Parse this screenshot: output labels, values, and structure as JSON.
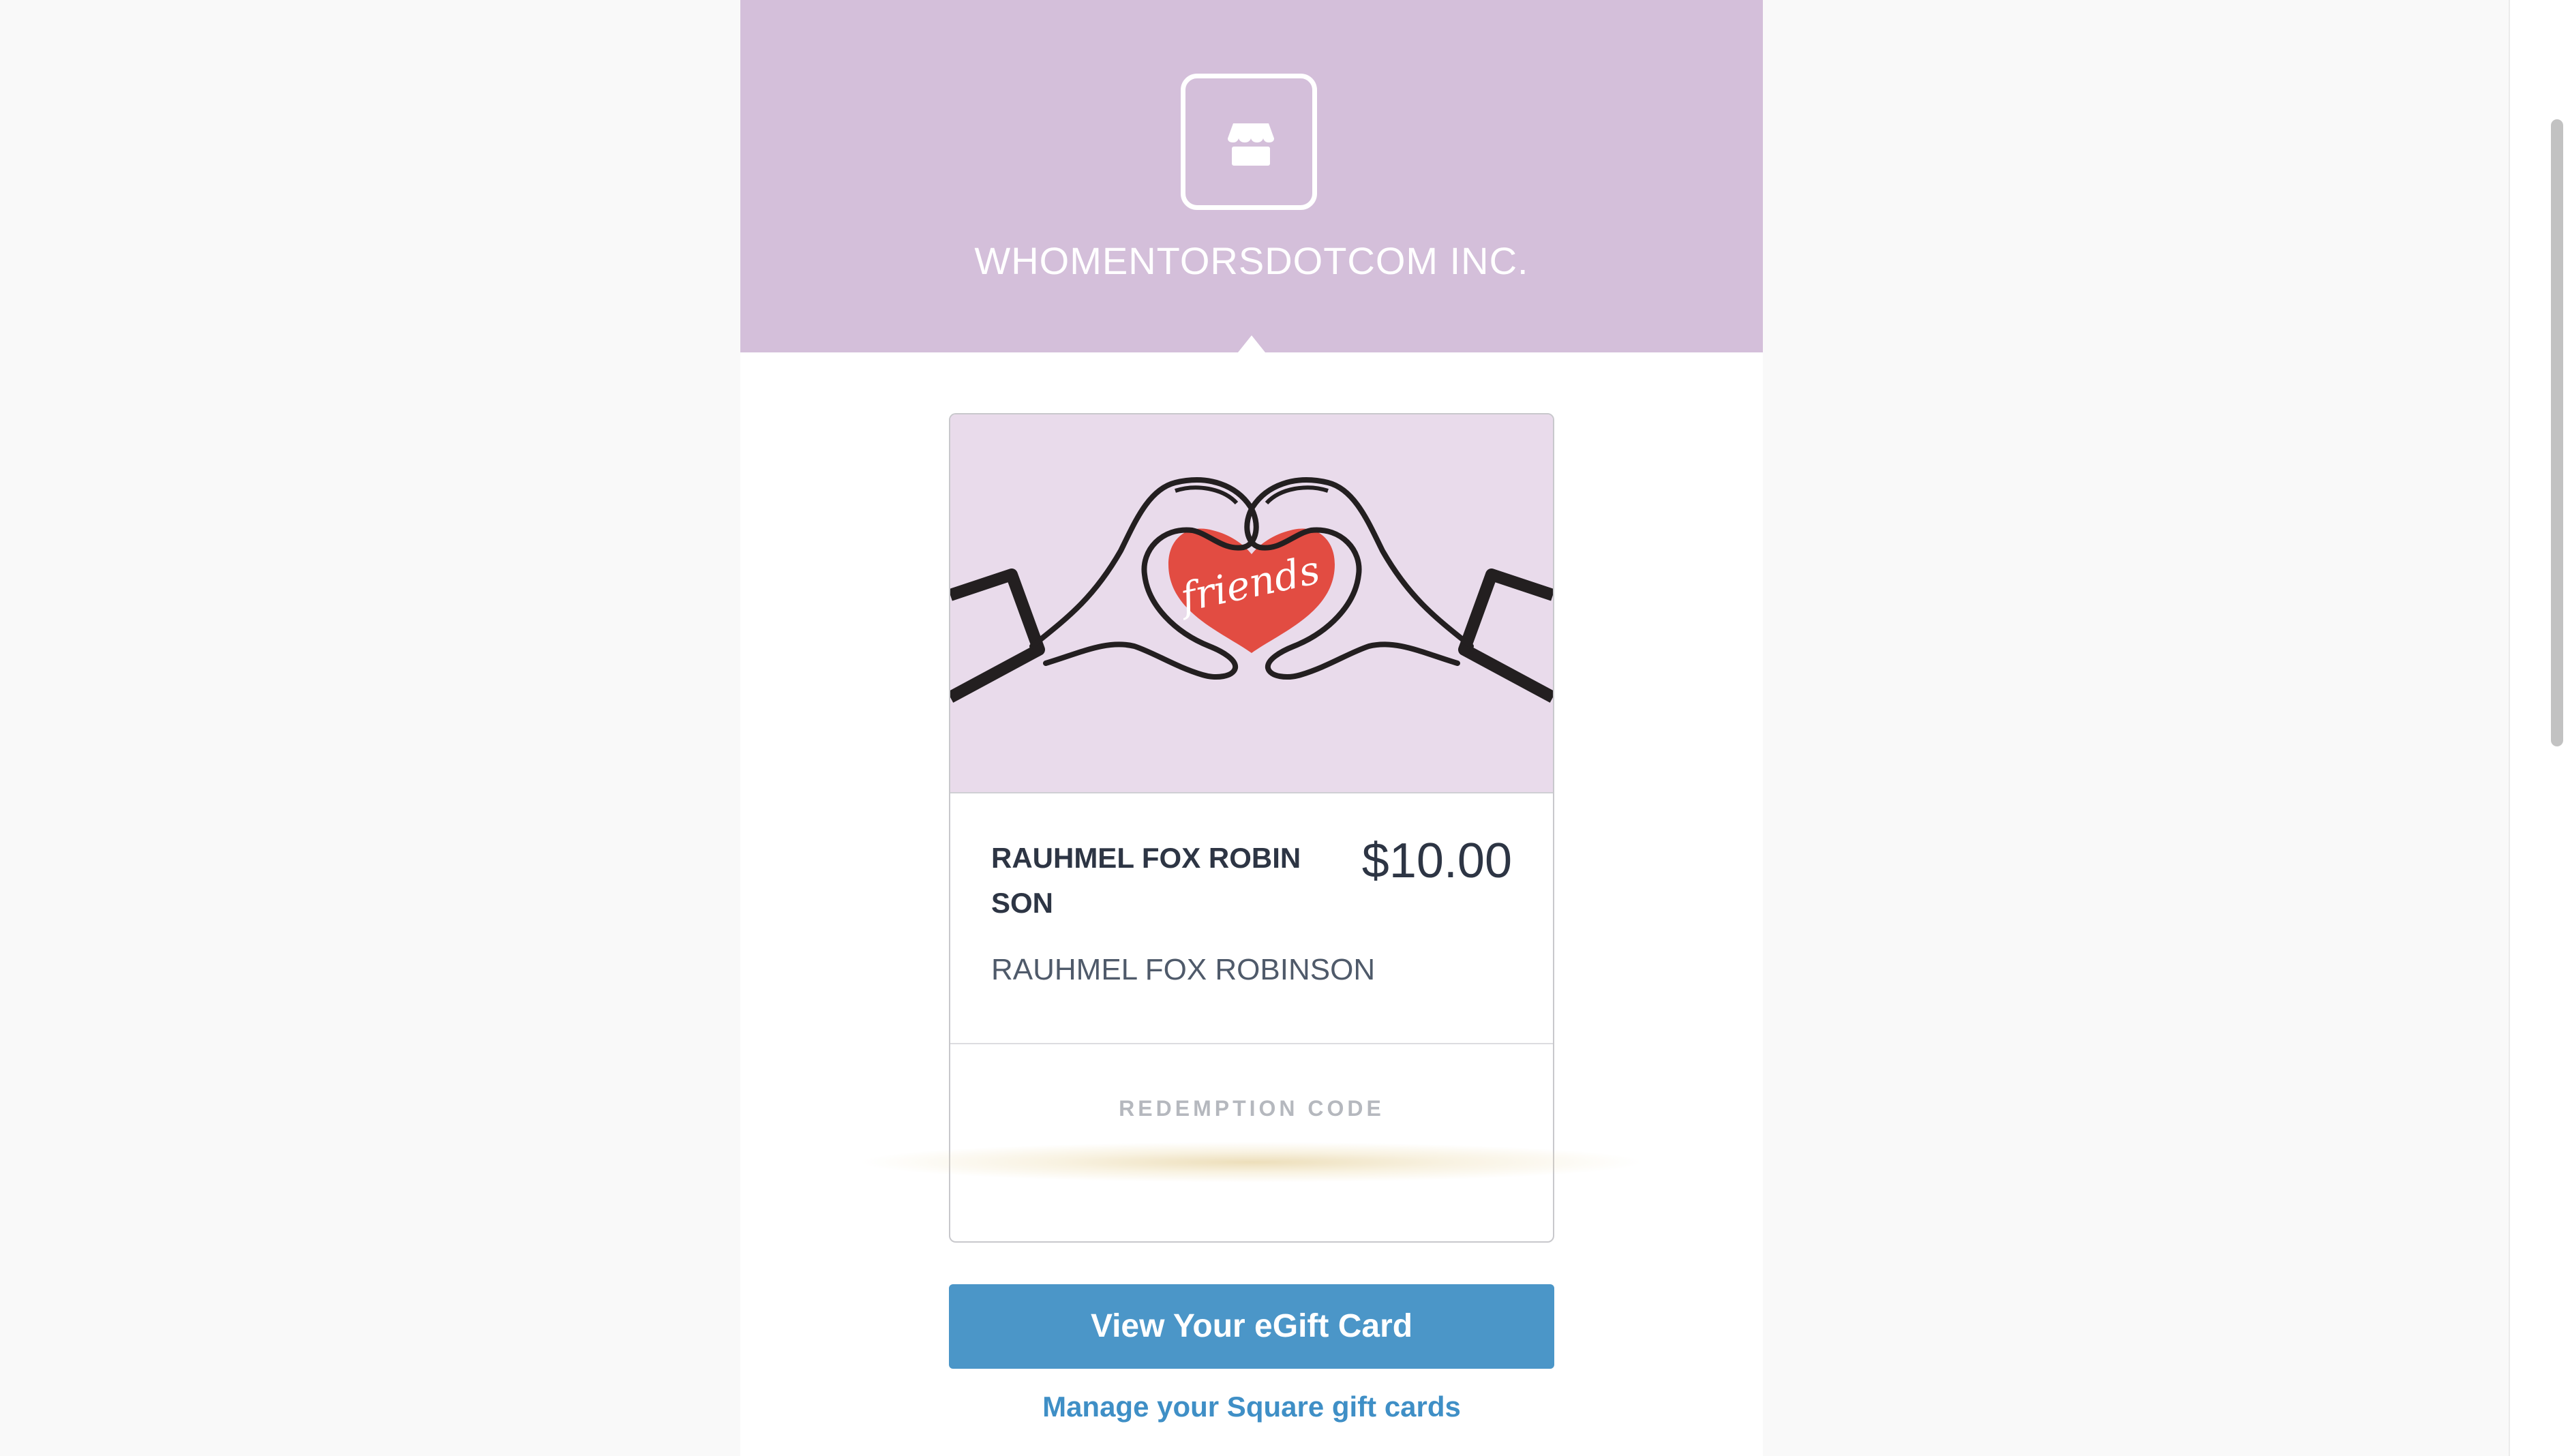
{
  "merchant": {
    "name": "WHOMENTORSDOTCOM INC.",
    "logo_icon": "storefront-icon",
    "header_color": "#d4bfda"
  },
  "card": {
    "art_text": "friends",
    "art_icon": "heart-hands-icon",
    "recipient_title": "RAUHMEL FOX ROBIN SON",
    "amount": "$10.00",
    "recipient_name": "RAUHMEL FOX ROBINSON",
    "redemption_label": "REDEMPTION CODE"
  },
  "actions": {
    "view_button": "View Your eGift Card",
    "manage_link": "Manage your Square gift cards",
    "accent_color": "#4b96c8"
  }
}
